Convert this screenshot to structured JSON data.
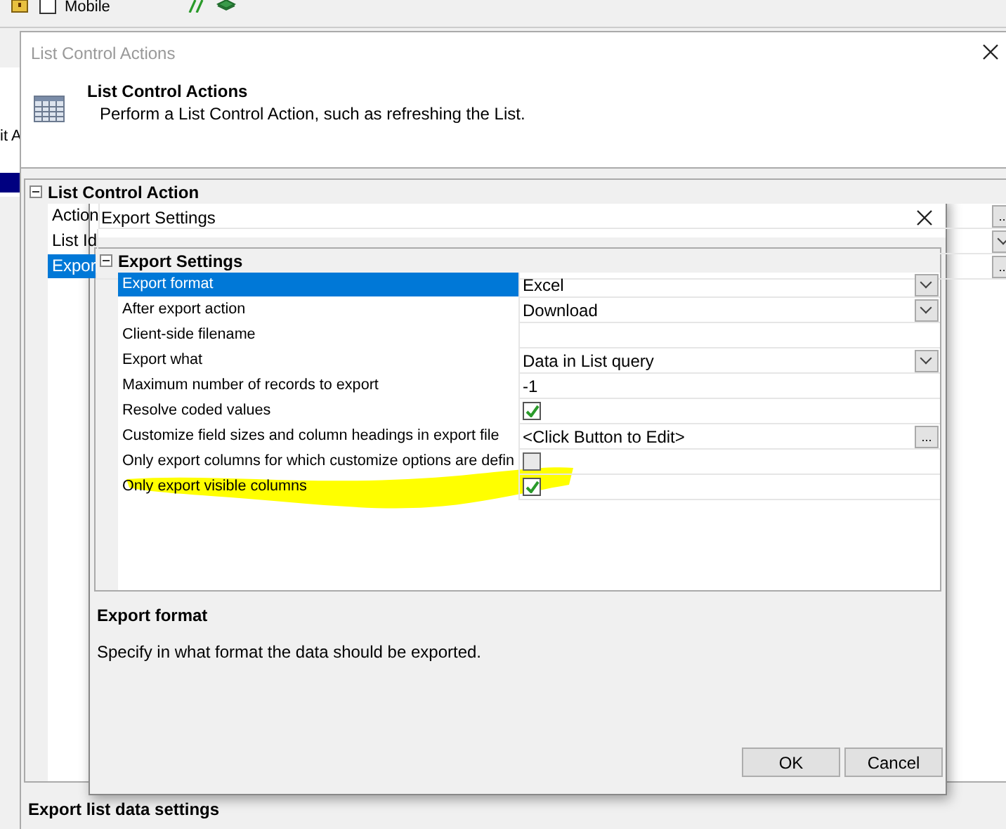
{
  "app_toolbar": {
    "mobile_checkbox": {
      "label": "Mobile",
      "checked": false
    }
  },
  "background_panel": {
    "text_fragment": "it A"
  },
  "list_control_dialog": {
    "title": "List Control Actions",
    "header_title": "List Control Actions",
    "header_description": "Perform a List Control Action, such as refreshing the List.",
    "grid": {
      "section": "List Control Action",
      "expanded": true,
      "rows": [
        {
          "name": "Action",
          "selected": false,
          "kind": "ellipsis",
          "button_text": "..."
        },
        {
          "name": "List Id",
          "selected": false,
          "kind": "dropdown"
        },
        {
          "name": "Expor",
          "selected": true,
          "kind": "ellipsis",
          "button_text": "..."
        }
      ]
    },
    "footer_title": "Export list data settings"
  },
  "export_dialog": {
    "title": "Export Settings",
    "grid": {
      "section": "Export Settings",
      "expanded": true,
      "rows": [
        {
          "name": "Export format",
          "value": "Excel",
          "kind": "dropdown",
          "selected": true
        },
        {
          "name": "After export action",
          "value": "Download",
          "kind": "dropdown",
          "selected": false
        },
        {
          "name": "Client-side filename",
          "kind": "text",
          "selected": false
        },
        {
          "name": "Export what",
          "value": "Data in List query",
          "kind": "dropdown",
          "selected": false
        },
        {
          "name": "Maximum number of records to export",
          "value": "-1",
          "kind": "text",
          "selected": false
        },
        {
          "name": "Resolve coded values",
          "kind": "checkbox",
          "checked": true,
          "selected": false
        },
        {
          "name": "Customize field sizes and column headings in export file",
          "value": "<Click Button to Edit>",
          "kind": "ellipsis",
          "button_text": "...",
          "selected": false
        },
        {
          "name": "Only export columns for which customize options are defin",
          "kind": "checkbox",
          "checked": false,
          "selected": false
        },
        {
          "name": "Only export visible columns",
          "kind": "checkbox",
          "checked": true,
          "selected": false
        }
      ]
    },
    "description_title": "Export format",
    "description_text": "Specify in what format the data should be exported.",
    "buttons": [
      {
        "label": "OK"
      },
      {
        "label": "Cancel"
      }
    ]
  }
}
